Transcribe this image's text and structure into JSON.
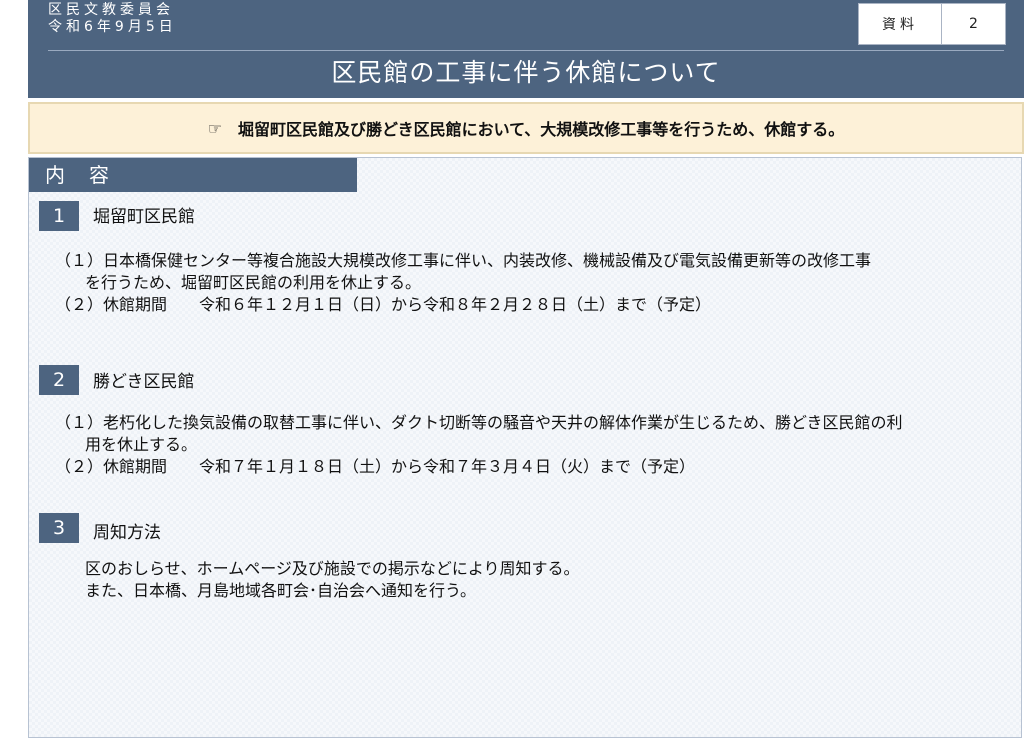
{
  "header": {
    "committee": "区民文教委員会",
    "date": "令和6年9月5日",
    "doc_label": "資料",
    "doc_number": "2",
    "title": "区民館の工事に伴う休館について"
  },
  "summary": {
    "icon": "pointing-hand-icon",
    "icon_glyph": "☞",
    "text": "堀留町区民館及び勝どき区民館において、大規模改修工事等を行うため、休館する。"
  },
  "content": {
    "tab_label": "内　容",
    "sections": [
      {
        "number": "1",
        "title": "堀留町区民館",
        "lines": [
          "（１）日本橋保健センター等複合施設大規模改修工事に伴い、内装改修、機械設備及び電気設備更新等の改修工事",
          "を行うため、堀留町区民館の利用を休止する。",
          "（２）休館期間　　令和６年１２月１日（日）から令和８年２月２８日（土）まで（予定）"
        ]
      },
      {
        "number": "2",
        "title": "勝どき区民館",
        "lines": [
          "（１）老朽化した換気設備の取替工事に伴い、ダクト切断等の騒音や天井の解体作業が生じるため、勝どき区民館の利",
          "用を休止する。",
          "（２）休館期間　　令和７年１月１８日（土）から令和７年３月４日（火）まで（予定）"
        ]
      },
      {
        "number": "3",
        "title": "周知方法",
        "lines": [
          "区のおしらせ、ホームページ及び施設での掲示などにより周知する。",
          "また、日本橋、月島地域各町会･自治会へ通知を行う。"
        ]
      }
    ]
  },
  "colors": {
    "header_bg": "#4d6480",
    "summary_bg": "#fdf1d8",
    "section_badge": "#4d6480"
  }
}
